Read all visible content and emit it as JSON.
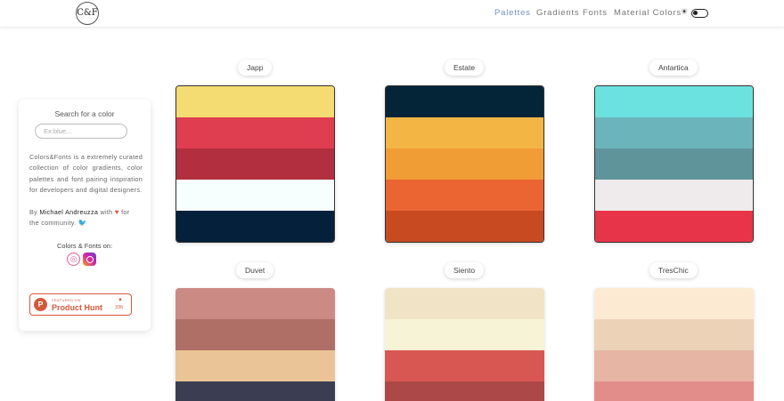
{
  "header": {
    "logo_text": "C&F",
    "nav": [
      "Palettes",
      "Gradients",
      "Fonts",
      "Material Colors"
    ],
    "active_nav": "Palettes",
    "theme_icon": "sun-icon"
  },
  "sidebar": {
    "search_title": "Search for a color",
    "search_placeholder": "Ex:blue...",
    "about": "Colors&Fonts is a extremely curated collection of color gradients, color palettes and font pairing inspiration for developers and digital designers.",
    "by_prefix": "By",
    "author": "Michael Andreuzza",
    "with_text": "with",
    "for_text": "for",
    "community": "the community.",
    "on_title": "Colors & Fonts on:",
    "producthunt": {
      "featured": "FEATURED ON",
      "name": "Product Hunt",
      "badge": "P",
      "votes": "336"
    }
  },
  "palettes": [
    {
      "name": "Japp",
      "colors": [
        "#F5DC72",
        "#DF3D50",
        "#B12F3F",
        "#F6FFFD",
        "#04203A"
      ]
    },
    {
      "name": "Estate",
      "colors": [
        "#042437",
        "#F3B645",
        "#F09D35",
        "#EA6531",
        "#C84A21"
      ]
    },
    {
      "name": "Antartica",
      "colors": [
        "#6CE2E0",
        "#6CB4BB",
        "#5F959A",
        "#EFEAEB",
        "#E83448"
      ]
    },
    {
      "name": "Duvet",
      "colors": [
        "#CB8A84",
        "#AF6F67",
        "#EAC497",
        "#3B3E52"
      ]
    },
    {
      "name": "Siento",
      "colors": [
        "#F1E3C5",
        "#F7F3D6",
        "#D85752",
        "#AC4848"
      ]
    },
    {
      "name": "TresChic",
      "colors": [
        "#FCEBD2",
        "#ECD2B7",
        "#E6B5A4",
        "#E28D89"
      ]
    }
  ]
}
